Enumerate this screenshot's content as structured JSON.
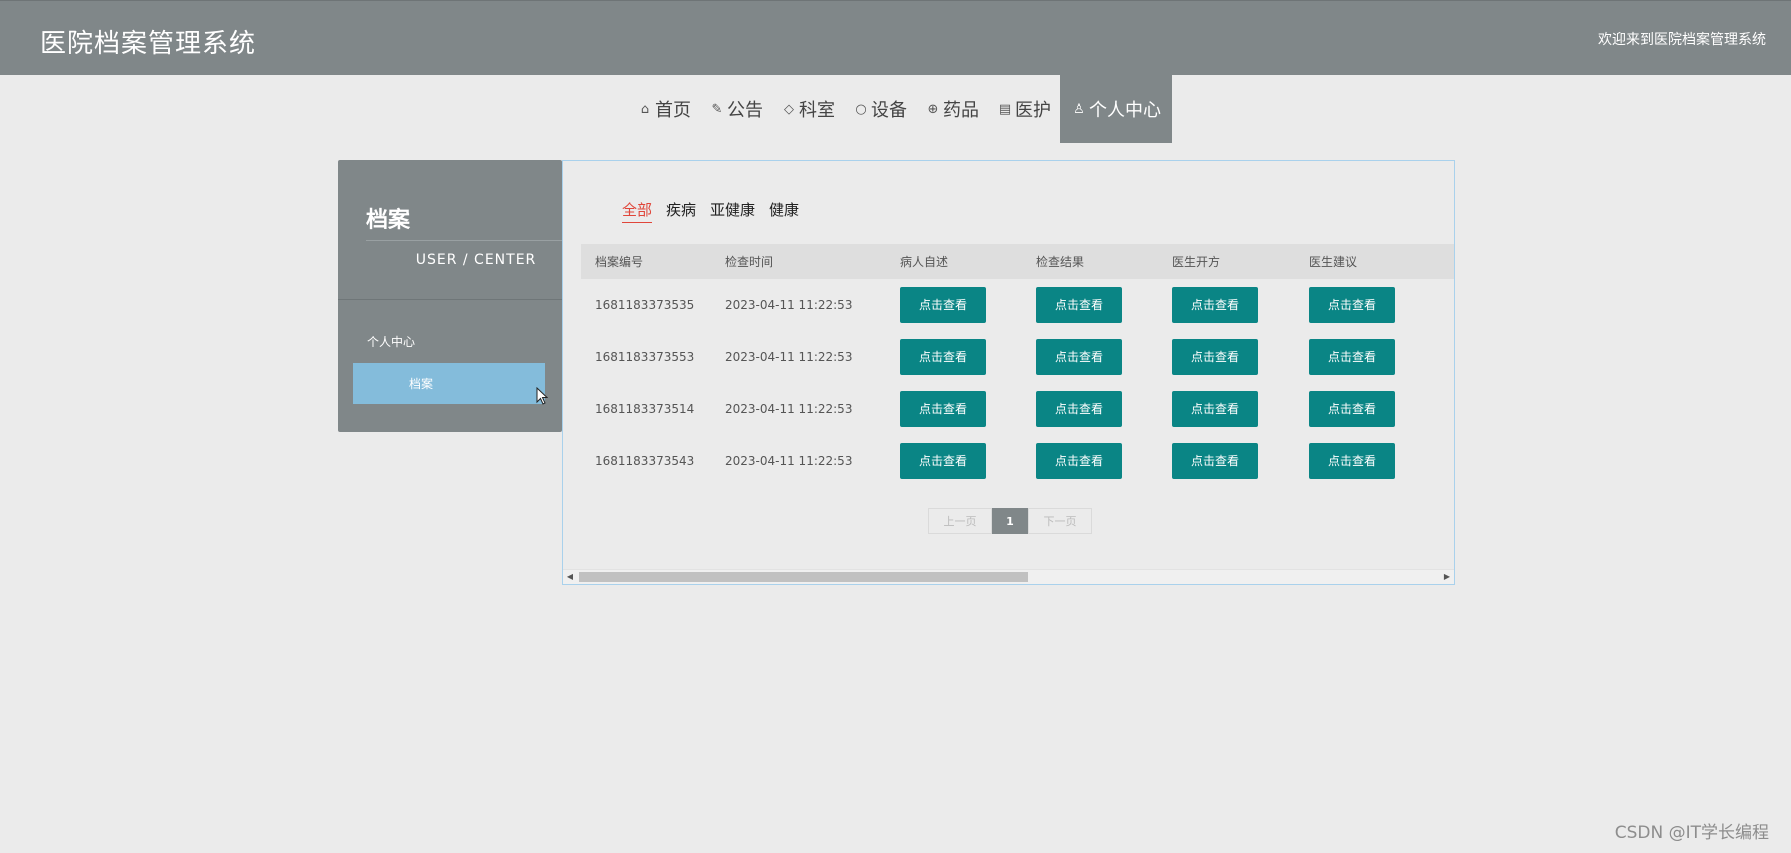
{
  "header": {
    "site_title": "医院档案管理系统",
    "welcome": "欢迎来到医院档案管理系统"
  },
  "nav": {
    "items": [
      {
        "label": "首页",
        "icon": "home-icon",
        "glyph": "⌂"
      },
      {
        "label": "公告",
        "icon": "palette-icon",
        "glyph": "✎"
      },
      {
        "label": "科室",
        "icon": "tag-icon",
        "glyph": "◇"
      },
      {
        "label": "设备",
        "icon": "circle-icon",
        "glyph": "○"
      },
      {
        "label": "药品",
        "icon": "globe-icon",
        "glyph": "⊕"
      },
      {
        "label": "医护",
        "icon": "clipboard-icon",
        "glyph": "▤"
      },
      {
        "label": "个人中心",
        "icon": "user-icon",
        "glyph": "♙"
      }
    ],
    "active_index": 6
  },
  "sidebar": {
    "title": "档案",
    "subtitle": "USER / CENTER",
    "menu_head": "个人中心",
    "menu_item": "档案"
  },
  "filters": {
    "items": [
      "全部",
      "疾病",
      "亚健康",
      "健康"
    ],
    "active": "全部"
  },
  "table": {
    "headers": [
      "档案编号",
      "检查时间",
      "病人自述",
      "检查结果",
      "医生开方",
      "医生建议"
    ],
    "button_label": "点击查看",
    "rows": [
      {
        "id": "1681183373535",
        "time": "2023-04-11 11:22:53"
      },
      {
        "id": "1681183373553",
        "time": "2023-04-11 11:22:53"
      },
      {
        "id": "1681183373514",
        "time": "2023-04-11 11:22:53"
      },
      {
        "id": "1681183373543",
        "time": "2023-04-11 11:22:53"
      }
    ]
  },
  "pager": {
    "prev": "上一页",
    "current": "1",
    "next": "下一页"
  },
  "watermark": "CSDN @IT学长编程",
  "colors": {
    "header_bg": "#808789",
    "sidebar_active": "#84bcdb",
    "button": "#0a8585",
    "filter_active": "#e0463a"
  }
}
